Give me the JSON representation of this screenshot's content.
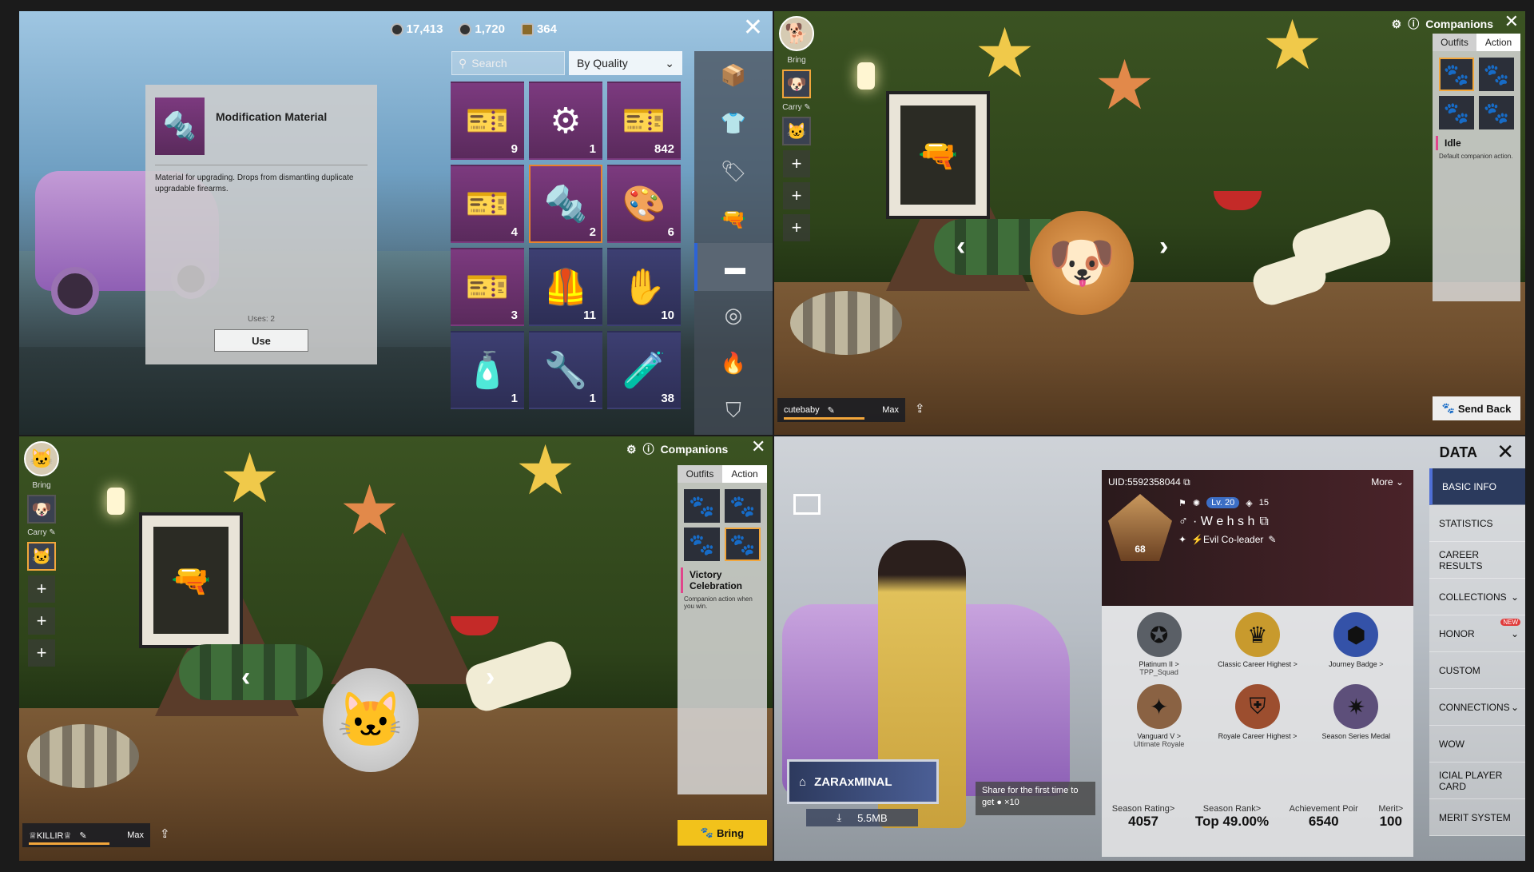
{
  "inventory": {
    "currency": [
      {
        "icon": "uc-coin-icon",
        "value": "17,413"
      },
      {
        "icon": "ag-coin-icon",
        "value": "1,720"
      },
      {
        "icon": "ticket-icon",
        "value": "364"
      }
    ],
    "search_placeholder": "Search",
    "sort_label": "By Quality",
    "detail": {
      "title": "Modification Material",
      "description": "Material for upgrading. Drops from dismantling duplicate upgradable firearms.",
      "uses": "Uses: 2",
      "use_label": "Use"
    },
    "items": [
      {
        "icon": "voucher-card-icon",
        "qty": "9",
        "color": "purple"
      },
      {
        "icon": "engine-icon",
        "qty": "1",
        "color": "purple"
      },
      {
        "icon": "voucher-card-icon",
        "qty": "842",
        "color": "purple"
      },
      {
        "icon": "voucher-card-icon",
        "qty": "4",
        "color": "purple"
      },
      {
        "icon": "modification-material-icon",
        "qty": "2",
        "color": "purple",
        "selected": true
      },
      {
        "icon": "color-palette-icon",
        "qty": "6",
        "color": "purple"
      },
      {
        "icon": "voucher-card-icon",
        "qty": "3",
        "color": "purple"
      },
      {
        "icon": "tactical-vest-icon",
        "qty": "11",
        "color": "blue"
      },
      {
        "icon": "emote-icon",
        "qty": "10",
        "color": "blue"
      },
      {
        "icon": "spray-can-icon",
        "qty": "1",
        "color": "blue"
      },
      {
        "icon": "rifle-part-icon",
        "qty": "1",
        "color": "blue"
      },
      {
        "icon": "spray-bottle-icon",
        "qty": "38",
        "color": "blue"
      }
    ],
    "categories": [
      "crate-icon",
      "outfit-icon",
      "sale-tag-icon",
      "gun-icon",
      "material-icon",
      "wheel-icon",
      "flame-icon",
      "parachute-icon",
      "box-icon",
      "helmet-icon",
      "cube-icon",
      "avatar-icon"
    ]
  },
  "dog_screen": {
    "title": "Companions",
    "tabs": [
      "Outfits",
      "Action"
    ],
    "action_name": "Idle",
    "action_desc": "Default companion action.",
    "bring_label": "Bring",
    "carry_label": "Carry",
    "name": "cutebaby",
    "level": "Max",
    "send_back_label": "Send Back",
    "progress": 0.7
  },
  "cat_screen": {
    "title": "Companions",
    "tabs": [
      "Outfits",
      "Action"
    ],
    "action_name": "Victory Celebration",
    "action_desc": "Companion action when you win.",
    "bring_label": "Bring",
    "carry_label": "Carry",
    "name": "♕KILLIR♕",
    "level": "Max",
    "bring_button": "Bring",
    "progress": 0.7
  },
  "profile": {
    "title": "DATA",
    "uid": "UID:5592358044",
    "more": "More",
    "level": "Lv. 20",
    "tier_level": "68",
    "honor": "15",
    "name": "· W e h s h",
    "clan": "⚡Evil  Co-leader",
    "badges": [
      {
        "icon": "platinum-badge-icon",
        "label": "Platinum II >",
        "sub": "TPP_Squad"
      },
      {
        "icon": "classic-career-icon",
        "label": "Classic Career Highest >",
        "sub": ""
      },
      {
        "icon": "journey-badge-icon",
        "label": "Journey Badge >",
        "sub": ""
      },
      {
        "icon": "vanguard-badge-icon",
        "label": "Vanguard V >",
        "sub": "Ultimate Royale"
      },
      {
        "icon": "royale-career-icon",
        "label": "Royale Career Highest >",
        "sub": ""
      },
      {
        "icon": "season-medal-icon",
        "label": "Season Series Medal",
        "sub": ""
      }
    ],
    "stats": [
      {
        "label": "Season Rating>",
        "value": "4057"
      },
      {
        "label": "Season Rank>",
        "value": "Top 49.00%"
      },
      {
        "label": "Achievement Poir",
        "value": "6540"
      },
      {
        "label": "Merit>",
        "value": "100"
      }
    ],
    "nav": [
      {
        "label": "BASIC INFO",
        "selected": true
      },
      {
        "label": "STATISTICS"
      },
      {
        "label": "CAREER RESULTS"
      },
      {
        "label": "COLLECTIONS",
        "chevron": true
      },
      {
        "label": "HONOR",
        "chevron": true,
        "badge": "NEW"
      },
      {
        "label": "CUSTOM"
      },
      {
        "label": "CONNECTIONS",
        "chevron": true
      },
      {
        "label": "WOW"
      },
      {
        "label": "ICIAL PLAYER CARD"
      },
      {
        "label": "MERIT SYSTEM"
      }
    ],
    "sign_name": "ZARAxMINAL",
    "download_size": "5.5MB",
    "share_text": "Share for the first time to get",
    "share_reward": "×10"
  }
}
